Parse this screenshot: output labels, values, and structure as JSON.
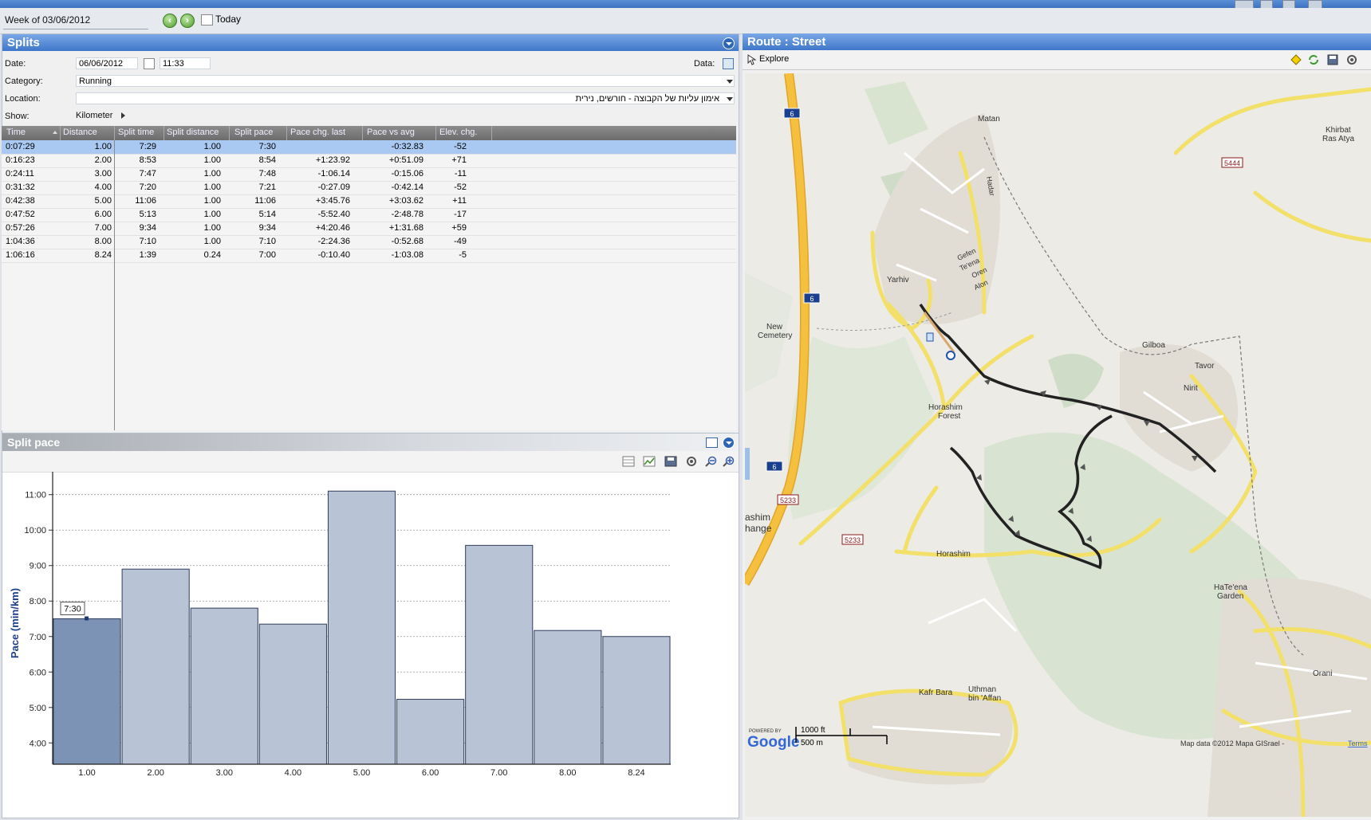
{
  "topbar": {
    "week_label": "Week of 03/06/2012",
    "today_label": "Today"
  },
  "splits": {
    "title": "Splits",
    "date_label": "Date:",
    "date_value": "06/06/2012",
    "time_value": "11:33",
    "data_label": "Data:",
    "category_label": "Category:",
    "category_value": "Running",
    "location_label": "Location:",
    "location_value": "אימון עליות של הקבוצה - חורשים, נירית",
    "show_label": "Show:",
    "show_value": "Kilometer",
    "columns": [
      "Time",
      "Distance",
      "Split time",
      "Split distance",
      "Split pace",
      "Pace chg. last",
      "Pace vs avg",
      "Elev. chg."
    ],
    "rows": [
      [
        "0:07:29",
        "1.00",
        "7:29",
        "1.00",
        "7:30",
        "",
        "-0:32.83",
        "-52"
      ],
      [
        "0:16:23",
        "2.00",
        "8:53",
        "1.00",
        "8:54",
        "+1:23.92",
        "+0:51.09",
        "+71"
      ],
      [
        "0:24:11",
        "3.00",
        "7:47",
        "1.00",
        "7:48",
        "-1:06.14",
        "-0:15.06",
        "-11"
      ],
      [
        "0:31:32",
        "4.00",
        "7:20",
        "1.00",
        "7:21",
        "-0:27.09",
        "-0:42.14",
        "-52"
      ],
      [
        "0:42:38",
        "5.00",
        "11:06",
        "1.00",
        "11:06",
        "+3:45.76",
        "+3:03.62",
        "+11"
      ],
      [
        "0:47:52",
        "6.00",
        "5:13",
        "1.00",
        "5:14",
        "-5:52.40",
        "-2:48.78",
        "-17"
      ],
      [
        "0:57:26",
        "7.00",
        "9:34",
        "1.00",
        "9:34",
        "+4:20.46",
        "+1:31.68",
        "+59"
      ],
      [
        "1:04:36",
        "8.00",
        "7:10",
        "1.00",
        "7:10",
        "-2:24.36",
        "-0:52.68",
        "-49"
      ],
      [
        "1:06:16",
        "8.24",
        "1:39",
        "0.24",
        "7:00",
        "-0:10.40",
        "-1:03.08",
        "-5"
      ]
    ]
  },
  "chart_panel": {
    "title": "Split pace"
  },
  "chart_data": {
    "type": "bar",
    "ylabel": "Pace (min/km)",
    "xlabel": "",
    "categories": [
      "1.00",
      "2.00",
      "3.00",
      "4.00",
      "5.00",
      "6.00",
      "7.00",
      "8.00",
      "8.24"
    ],
    "values": [
      7.5,
      8.9,
      7.8,
      7.35,
      11.1,
      5.23,
      9.57,
      7.17,
      7.0
    ],
    "widths": [
      1,
      1,
      1,
      1,
      1,
      1,
      1,
      1,
      1
    ],
    "ytick_labels": [
      "4:00",
      "5:00",
      "6:00",
      "7:00",
      "8:00",
      "9:00",
      "10:00",
      "11:00"
    ],
    "yticks": [
      4,
      5,
      6,
      7,
      8,
      9,
      10,
      11
    ],
    "ylim": [
      3.4,
      11.6
    ],
    "selected_index": 0,
    "tooltip": "7:30",
    "colors": {
      "bar": "#b9c3d6",
      "bar_selected": "#7d93b5",
      "bar_stroke": "#2f3e5c"
    }
  },
  "route": {
    "title": "Route : Street",
    "explore_label": "Explore",
    "map_labels": {
      "matan": "Matan",
      "yarhiv": "Yarhiv",
      "new_cemetery_1": "New",
      "new_cemetery_2": "Cemetery",
      "horashim_forest_1": "Horashim",
      "horashim_forest_2": "Forest",
      "horashim": "Horashim",
      "nirit": "Nirit",
      "tavor": "Tavor",
      "gilboa": "Gilboa",
      "kafr_bara": "Kafr Bara",
      "uthman_1": "Uthman",
      "uthman_2": "bin 'Affan",
      "hateena_1": "HaTe'ena",
      "hateena_2": "Garden",
      "orani": "Orani",
      "khirbat_1": "Khirbat",
      "khirbat_2": "Ras Atya",
      "interchange_1": "ashim",
      "interchange_2": "hange",
      "alon": "Alon",
      "oren": "Oren",
      "teena": "Te'ena",
      "gefen": "Gefen",
      "hadar": "Hadar",
      "rd6a": "6",
      "rd6b": "6",
      "rd6c": "6",
      "rd5444": "5444",
      "rd5233a": "5233",
      "rd5233b": "5233",
      "powered_by": "POWERED BY",
      "google": "Google",
      "scale_ft": "1000 ft",
      "scale_m": "500 m",
      "copyright": "Map data ©2012 Mapa GISrael -",
      "terms": "Terms"
    }
  }
}
